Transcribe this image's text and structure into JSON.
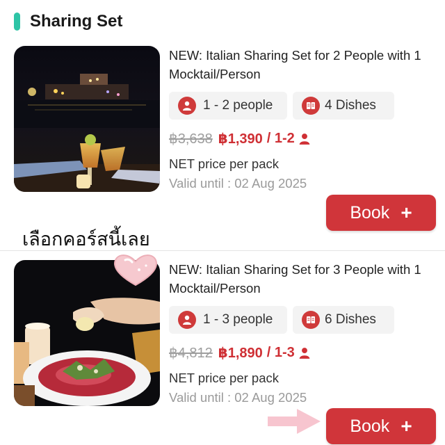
{
  "section": {
    "title": "Sharing Set"
  },
  "overlay": {
    "caption": "เลือกคอร์สนี้เลย"
  },
  "cards": [
    {
      "title": "NEW: Italian Sharing Set for 2 People with 1 Mocktail/Person",
      "people": "1 - 2 people",
      "dishes": "4 Dishes",
      "old_price": "฿3,638",
      "new_price": "฿1,390",
      "unit": "/ 1-2",
      "net": "NET price per pack",
      "valid": "Valid until : 02 Aug 2025",
      "book_label": "Book"
    },
    {
      "title": "NEW: Italian Sharing Set for 3 People with 1 Mocktail/Person",
      "people": "1 - 3 people",
      "dishes": "6 Dishes",
      "old_price": "฿4,812",
      "new_price": "฿1,890",
      "unit": "/ 1-3",
      "net": "NET price per pack",
      "valid": "Valid until : 02 Aug 2025",
      "book_label": "Book"
    }
  ],
  "icons": {
    "accent": "#2ec4a6",
    "brand_red": "#cf3a3a",
    "people_icon": "person-icon",
    "dishes_icon": "menu-book-icon",
    "plus_icon": "plus-icon"
  }
}
